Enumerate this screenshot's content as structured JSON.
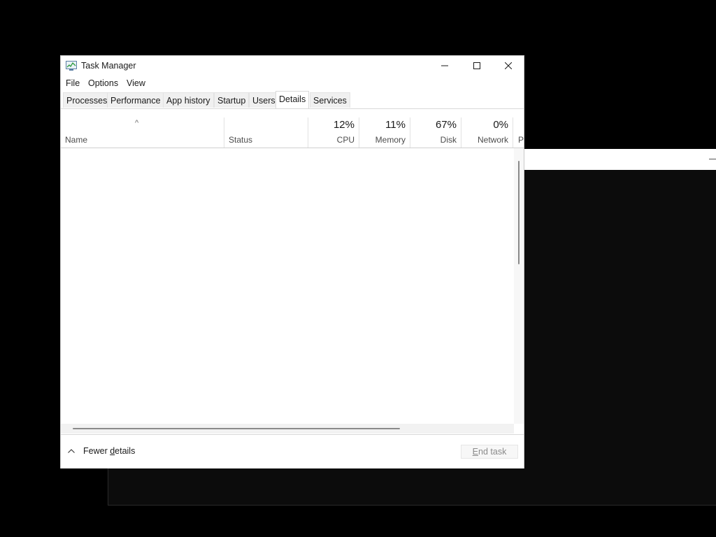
{
  "window": {
    "title": "Task Manager",
    "app_icon": "task-manager-icon",
    "controls": [
      "minimize-icon",
      "maximize-icon",
      "close-icon"
    ]
  },
  "menu": {
    "items": [
      {
        "label": "File"
      },
      {
        "label": "Options"
      },
      {
        "label": "View"
      }
    ]
  },
  "tabs": {
    "items": [
      {
        "label": "Processes"
      },
      {
        "label": "Performance"
      },
      {
        "label": "App history"
      },
      {
        "label": "Startup"
      },
      {
        "label": "Users"
      },
      {
        "label": "Details"
      },
      {
        "label": "Services"
      }
    ],
    "active": "Details"
  },
  "columns": {
    "sort_indicator": "^",
    "name": {
      "label": "Name"
    },
    "status": {
      "label": "Status"
    },
    "cpu": {
      "percent": "12%",
      "label": "CPU"
    },
    "memory": {
      "percent": "11%",
      "label": "Memory"
    },
    "disk": {
      "percent": "67%",
      "label": "Disk"
    },
    "network": {
      "percent": "0%",
      "label": "Network"
    },
    "power": {
      "label": "P"
    }
  },
  "footer": {
    "fewer_details_prefix": "Fewer ",
    "fewer_details_underlined": "d",
    "fewer_details_suffix": "etails",
    "end_task_prefix": "",
    "end_task_underlined": "E",
    "end_task_suffix": "nd task"
  }
}
